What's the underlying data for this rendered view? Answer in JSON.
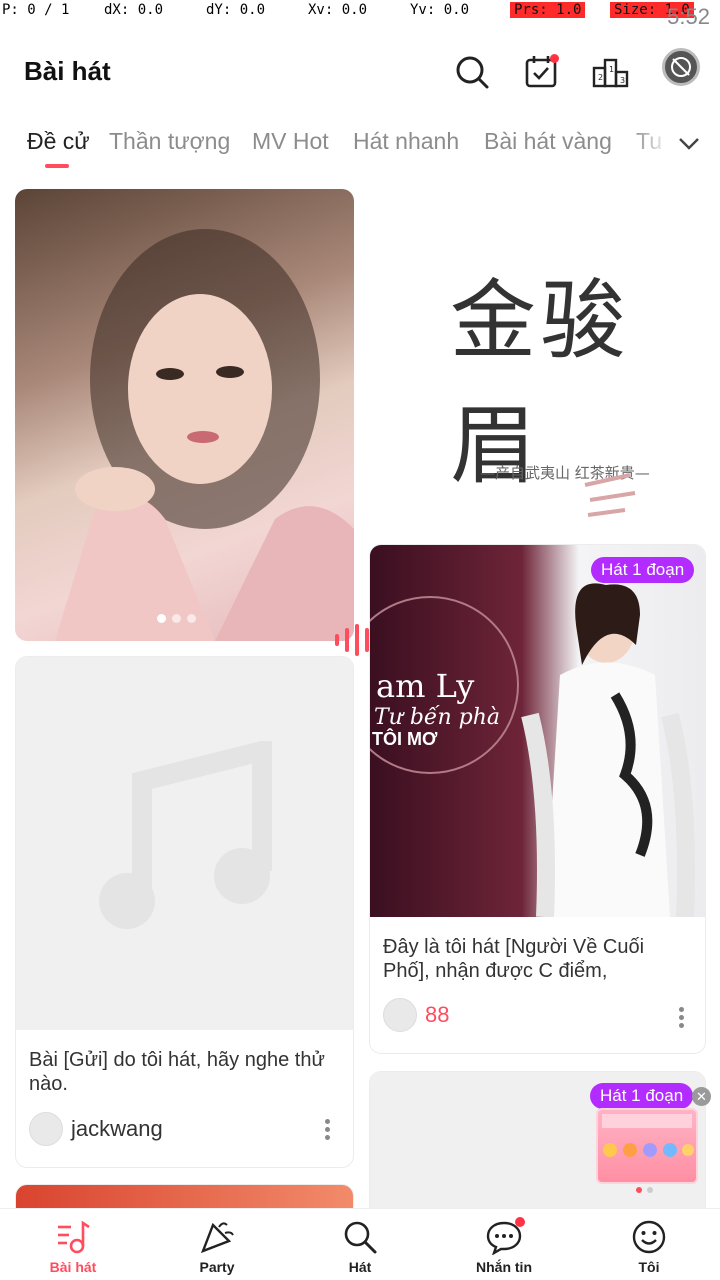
{
  "debug": {
    "p": "P: 0 / 1",
    "dx": "dX: 0.0",
    "dy": "dY: 0.0",
    "xv": "Xv: 0.0",
    "yv": "Yv: 0.0",
    "prs": "Prs: 1.0",
    "size": "Size: 1.0",
    "time": "5:52"
  },
  "header": {
    "title": "Bài hát"
  },
  "tabs": [
    "Đề cử",
    "Thần tượng",
    "MV Hot",
    "Hát nhanh",
    "Bài hát vàng",
    "Tu"
  ],
  "poster": {
    "cjk_title": "金骏眉",
    "cjk_sub": "—产自武夷山 红茶新贵—"
  },
  "cards": {
    "left_placeholder": {
      "title": "Bài [Gửi] do tôi hát, hãy nghe thử nào.",
      "user": "jackwang"
    },
    "right_aodai": {
      "badge": "Hát 1 đoạn",
      "overlay_text_1": "am Ly",
      "overlay_text_2": "Tư bến phà",
      "overlay_text_3": "TÔI MƠ",
      "title": "Đây là tôi hát [Người Về Cuối Phố], nhận được C điểm,",
      "score": "88"
    },
    "right_bottom": {
      "badge": "Hát 1 đoạn"
    }
  },
  "bottom_nav": [
    {
      "label": "Bài hát",
      "active": true
    },
    {
      "label": "Party",
      "active": false
    },
    {
      "label": "Hát",
      "active": false
    },
    {
      "label": "Nhắn tin",
      "active": false
    },
    {
      "label": "Tôi",
      "active": false
    }
  ],
  "colors": {
    "accent": "#ff4d5e",
    "badge": "#b32cff",
    "tab_inactive": "#8c8c8c"
  }
}
